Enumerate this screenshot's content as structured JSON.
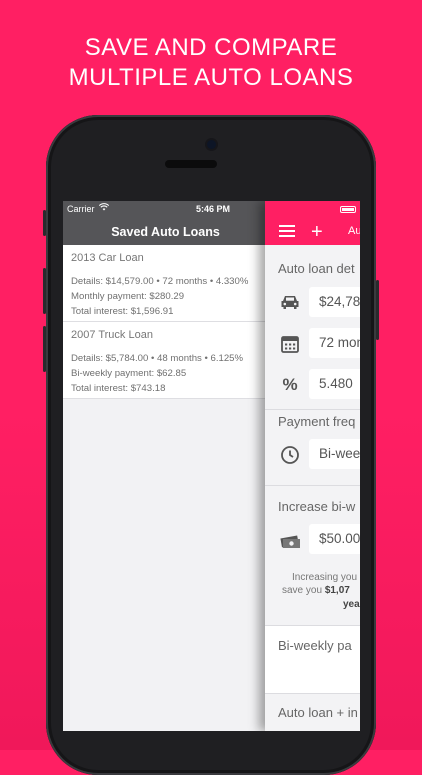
{
  "headline": {
    "line1": "SAVE AND COMPARE",
    "line2": "MULTIPLE AUTO LOANS"
  },
  "status_bar": {
    "carrier": "Carrier",
    "time": "5:46 PM"
  },
  "saved_panel": {
    "title": "Saved Auto Loans",
    "loans": [
      {
        "name": "2013 Car Loan",
        "details": "Details: $14,579.00 • 72 months • 4.330%",
        "payment": "Monthly payment: $280.29",
        "interest": "Total interest: $1,596.91"
      },
      {
        "name": "2007 Truck Loan",
        "details": "Details: $5,784.00 • 48 months • 6.125%",
        "payment": "Bi-weekly payment: $62.85",
        "interest": "Total interest: $743.18"
      }
    ]
  },
  "calculator": {
    "nav_title": "Au",
    "details_label": "Auto loan det",
    "amount": "$24,78",
    "term": "72 mont",
    "rate": "5.480",
    "frequency_label": "Payment freq",
    "frequency": "Bi-week",
    "increase_label": "Increase bi-w",
    "extra": "$50.00",
    "note_line1": "Increasing you",
    "note_line2_prefix": "save you ",
    "note_line2_bold": "$1,07",
    "note_line3_bold": "yea",
    "payment_label": "Bi-weekly pa",
    "total_label": "Auto loan + in"
  },
  "icons": {
    "menu": "hamburger-icon",
    "add": "plus-icon",
    "car": "car-icon",
    "calendar": "calendar-icon",
    "percent": "percent-icon",
    "clock": "clock-icon",
    "money": "money-icon"
  },
  "colors": {
    "brand": "#ff1f63",
    "left_header": "#555558"
  }
}
